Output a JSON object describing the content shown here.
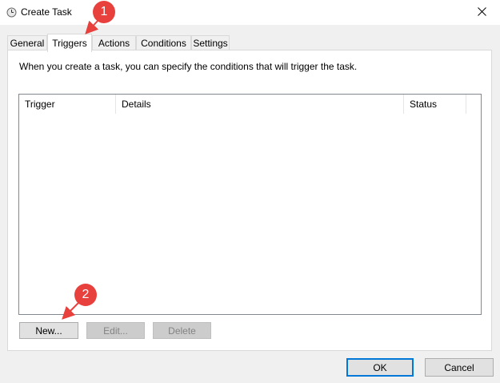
{
  "window": {
    "title": "Create Task",
    "title_icon": "task-scheduler-clock-icon",
    "close_icon": "close-icon"
  },
  "tabs": [
    {
      "label": "General",
      "active": false
    },
    {
      "label": "Triggers",
      "active": true
    },
    {
      "label": "Actions",
      "active": false
    },
    {
      "label": "Conditions",
      "active": false
    },
    {
      "label": "Settings",
      "active": false
    }
  ],
  "triggers_panel": {
    "description": "When you create a task, you can specify the conditions that will trigger the task.",
    "columns": [
      "Trigger",
      "Details",
      "Status"
    ],
    "rows": [],
    "buttons": {
      "new": "New...",
      "edit": "Edit...",
      "delete": "Delete"
    }
  },
  "dialog_buttons": {
    "ok": "OK",
    "cancel": "Cancel"
  },
  "annotations": {
    "marker_1": "1",
    "marker_2": "2",
    "color": "#e8413d"
  },
  "colors": {
    "default_button_border": "#0078d7",
    "window_bg": "#f0f0f0"
  }
}
